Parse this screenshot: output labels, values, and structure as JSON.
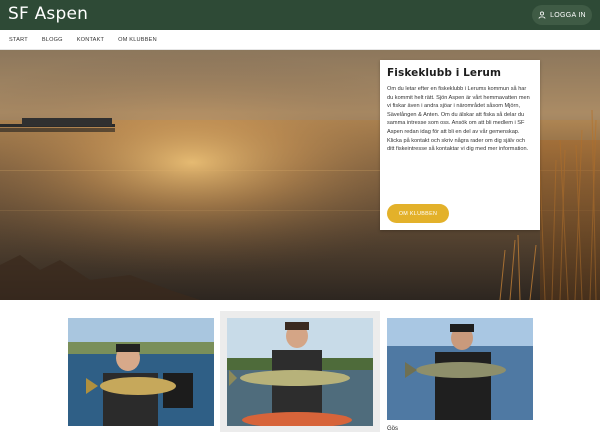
{
  "site": {
    "title": "SF Aspen"
  },
  "header": {
    "login_label": "LOGGA IN",
    "login_icon": "user-icon"
  },
  "nav": {
    "items": [
      "START",
      "BLOGG",
      "KONTAKT",
      "OM KLUBBEN"
    ]
  },
  "hero": {
    "title": "Fiskeklubb i Lerum",
    "body": "Om du letar efter en fiskeklubb i Lerums kommun så har du kommit helt rätt. Sjön Aspen är vårt hemmavatten men vi fiskar även i andra sjöar i närområdet såsom Mjörn, Sävelången & Anten. Om du älskar att fiska så delar du samma intresse som oss. Ansök om att bli medlem i SF Aspen redan idag för att bli en del av vår gemenskap. Klicka på kontakt och skriv några rader om dig själv och ditt fiskeintresse så kontaktar vi dig med mer information.",
    "cta_label": "OM KLUBBEN"
  },
  "photos": {
    "caption_3": "Gös"
  },
  "colors": {
    "header_bg": "#2e4a36",
    "accent": "#e3b12a"
  }
}
